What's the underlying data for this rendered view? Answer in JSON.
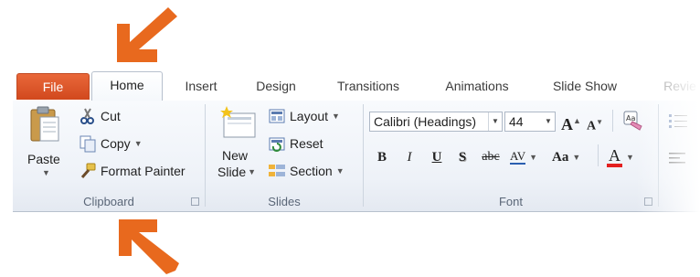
{
  "colors": {
    "accent_orange": "#e8691e",
    "file_tab": "#d64e22"
  },
  "tabs": [
    {
      "label": "File"
    },
    {
      "label": "Home"
    },
    {
      "label": "Insert"
    },
    {
      "label": "Design"
    },
    {
      "label": "Transitions"
    },
    {
      "label": "Animations"
    },
    {
      "label": "Slide Show"
    },
    {
      "label": "Revie"
    }
  ],
  "clipboard": {
    "paste_label": "Paste",
    "cut_label": "Cut",
    "copy_label": "Copy",
    "format_painter_label": "Format Painter",
    "group_label": "Clipboard"
  },
  "slides": {
    "new_slide_line1": "New",
    "new_slide_line2": "Slide",
    "layout_label": "Layout",
    "reset_label": "Reset",
    "section_label": "Section",
    "group_label": "Slides"
  },
  "font": {
    "font_name": "Calibri (Headings)",
    "font_size": "44",
    "bold": "B",
    "italic": "I",
    "underline": "U",
    "shadow": "S",
    "strikethrough": "abc",
    "char_spacing": "AV",
    "change_case": "Aa",
    "font_color": "A",
    "grow": "A",
    "shrink": "A",
    "group_label": "Font"
  }
}
